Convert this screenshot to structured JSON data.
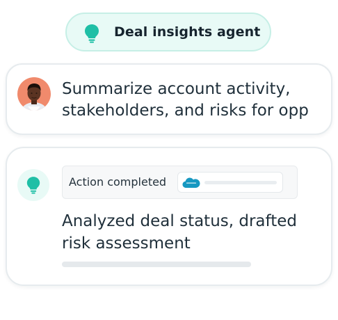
{
  "agent_pill": {
    "label": "Deal insights agent",
    "icon": "lightbulb-icon"
  },
  "user_message": {
    "avatar": "avatar",
    "lines": [
      "Summarize account activity,",
      "stakeholders, and risks for opp"
    ]
  },
  "agent_message": {
    "icon": "lightbulb-icon",
    "action": {
      "label": "Action completed",
      "source_icon": "salesforce-cloud-icon"
    },
    "lines": [
      "Analyzed deal status, drafted",
      "risk assessment"
    ]
  },
  "colors": {
    "accent": "#1fbfa6",
    "pill_bg": "#e8faf6",
    "avatar_bg": "#f08a6c",
    "salesforce": "#1798c1"
  }
}
